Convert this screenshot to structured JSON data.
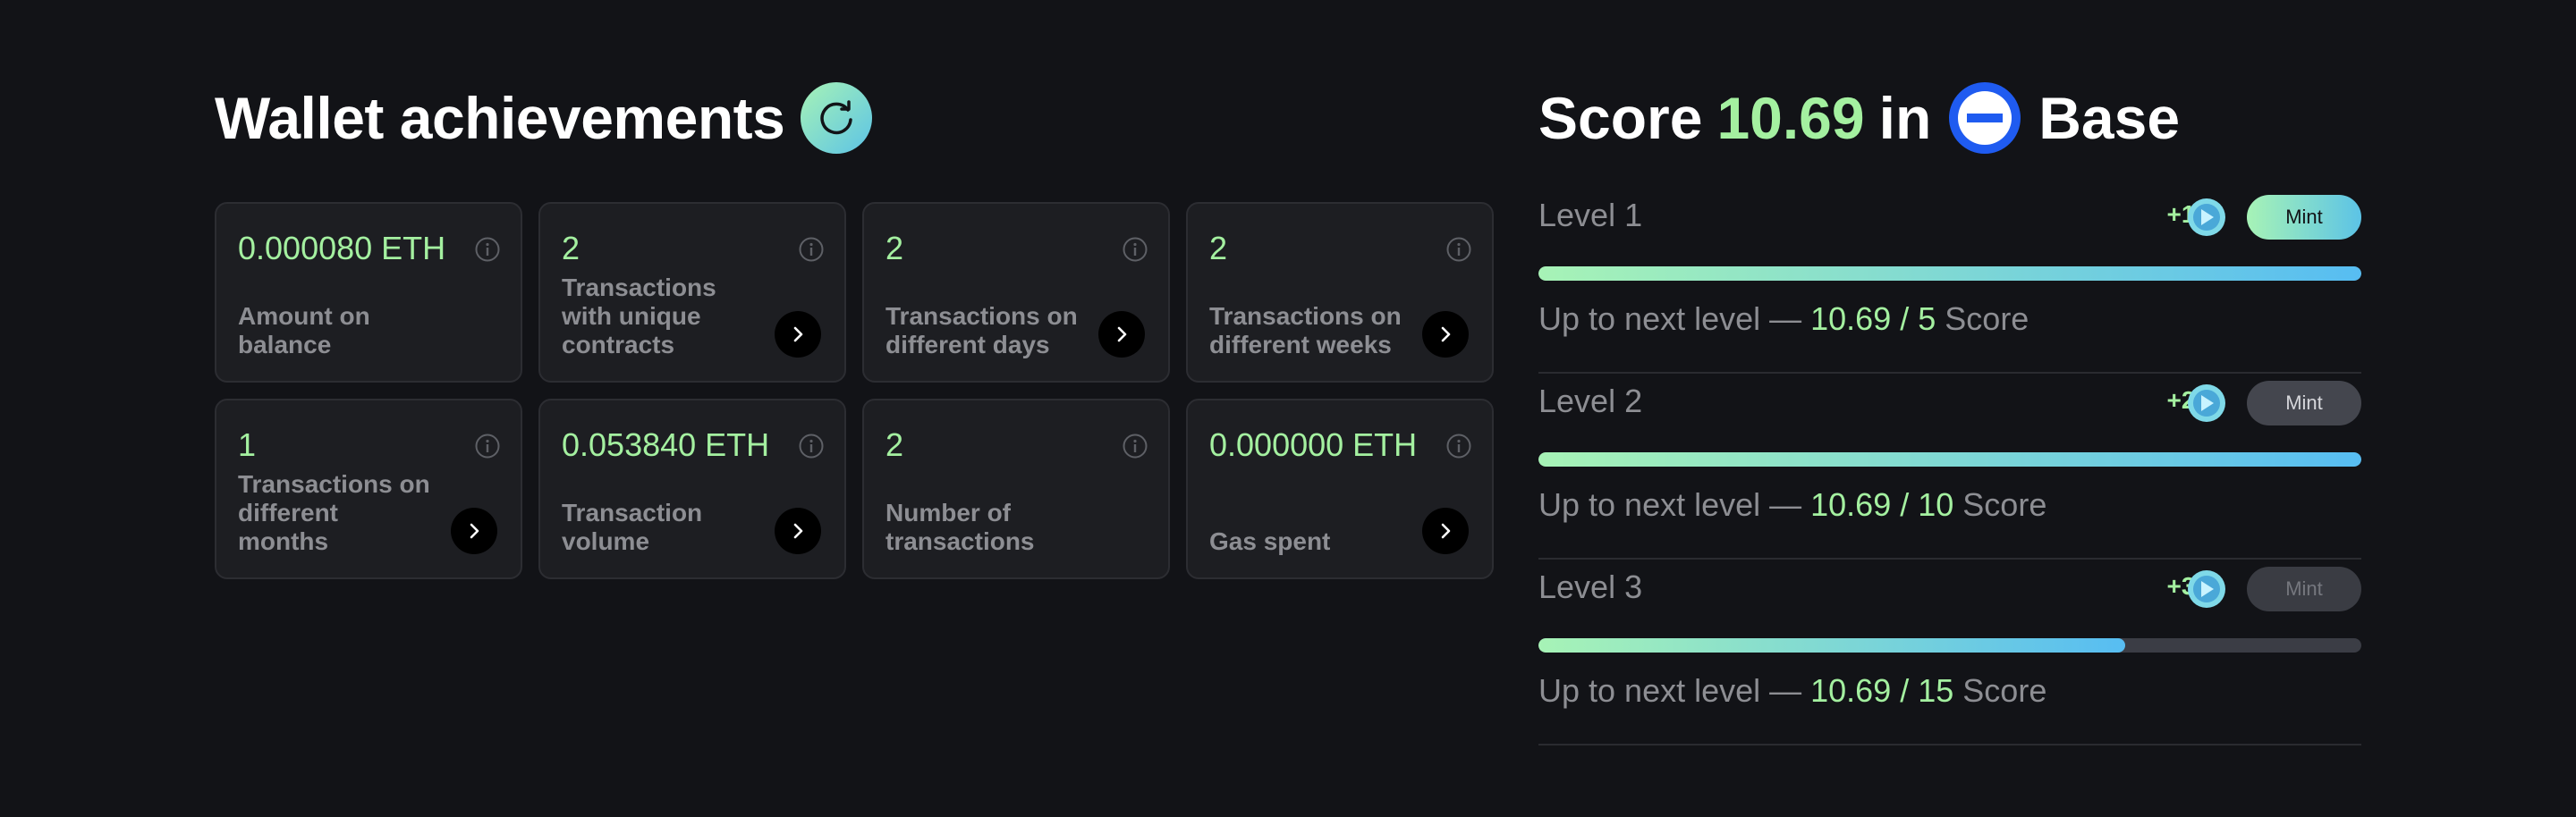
{
  "achievements": {
    "title": "Wallet achievements",
    "cards": [
      {
        "value": "0.000080 ETH",
        "label": "Amount on balance",
        "has_arrow": false
      },
      {
        "value": "2",
        "label": "Transactions with unique contracts",
        "has_arrow": true
      },
      {
        "value": "2",
        "label": "Transactions on different days",
        "has_arrow": true
      },
      {
        "value": "2",
        "label": "Transactions on different weeks",
        "has_arrow": true
      },
      {
        "value": "1",
        "label": "Transactions on different months",
        "has_arrow": true
      },
      {
        "value": "0.053840 ETH",
        "label": "Transaction volume",
        "has_arrow": true
      },
      {
        "value": "2",
        "label": "Number of transactions",
        "has_arrow": false
      },
      {
        "value": "0.000000 ETH",
        "label": "Gas spent",
        "has_arrow": true
      }
    ]
  },
  "score": {
    "prefix": "Score",
    "value": "10.69",
    "in_word": "in",
    "network": "Base",
    "levels": [
      {
        "name": "Level 1",
        "points": "+10",
        "mint_label": "Mint",
        "mint_state": "active",
        "progress": 1.0,
        "next_prefix": "Up to next level — ",
        "current": "10.69",
        "separator": " / ",
        "target": "5",
        "suffix": " Score"
      },
      {
        "name": "Level 2",
        "points": "+20",
        "mint_label": "Mint",
        "mint_state": "inactive",
        "progress": 1.0,
        "next_prefix": "Up to next level — ",
        "current": "10.69",
        "separator": " / ",
        "target": "10",
        "suffix": " Score"
      },
      {
        "name": "Level 3",
        "points": "+30",
        "mint_label": "Mint",
        "mint_state": "disabled",
        "progress": 0.7127,
        "next_prefix": "Up to next level — ",
        "current": "10.69",
        "separator": " / ",
        "target": "15",
        "suffix": " Score"
      }
    ]
  },
  "colors": {
    "background": "#121317",
    "accent_green": "#a4f0a0",
    "accent_blue": "#57bdf2",
    "base_blue": "#1f5bf0"
  },
  "icons": {
    "refresh": "refresh-icon",
    "info": "info-icon",
    "arrow": "chevron-right-icon",
    "network": "base-logo-icon",
    "coin": "points-coin-icon"
  }
}
